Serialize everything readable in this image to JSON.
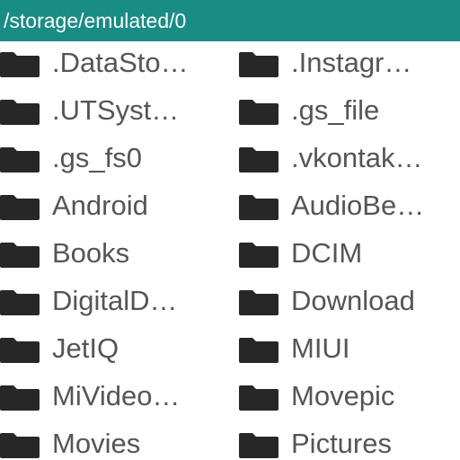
{
  "header": {
    "path": "/storage/emulated/0",
    "bar_color": "#198c84"
  },
  "folder_icon": "folder-icon",
  "folders": [
    {
      "left": ".DataSto…",
      "right": ".Instagr…"
    },
    {
      "left": ".UTSyst…",
      "right": ".gs_file"
    },
    {
      "left": ".gs_fs0",
      "right": ".vkontak…"
    },
    {
      "left": "Android",
      "right": "AudioBe…"
    },
    {
      "left": "Books",
      "right": "DCIM"
    },
    {
      "left": "DigitalD…",
      "right": "Download"
    },
    {
      "left": "JetIQ",
      "right": "MIUI"
    },
    {
      "left": "MiVideo…",
      "right": "Movepic"
    },
    {
      "left": "Movies",
      "right": "Pictures"
    }
  ]
}
